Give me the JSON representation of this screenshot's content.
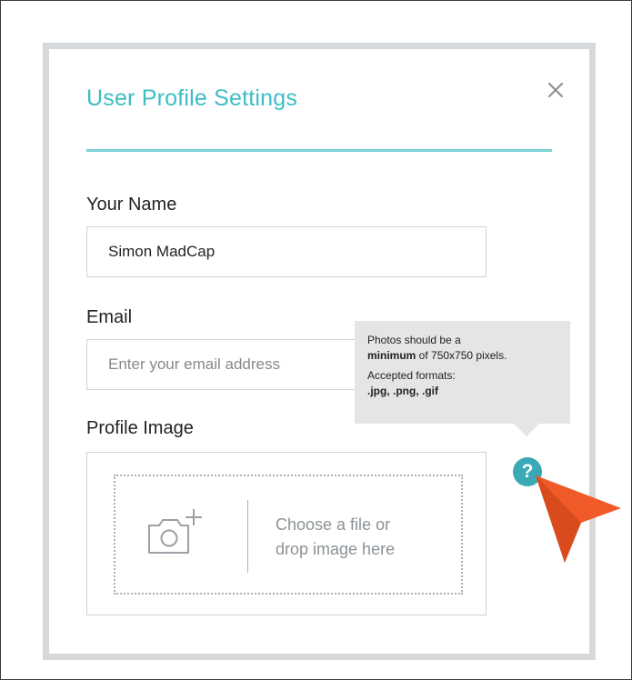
{
  "dialog": {
    "title": "User Profile Settings",
    "close_icon": "close-icon"
  },
  "fields": {
    "name_label": "Your Name",
    "name_value": "Simon MadCap",
    "email_label": "Email",
    "email_placeholder": "Enter your email address",
    "image_label": "Profile Image"
  },
  "upload": {
    "icon": "camera-add-icon",
    "line1": "Choose a file or",
    "line2": "drop image here"
  },
  "tooltip": {
    "line1": "Photos should be a",
    "line2_bold": "minimum",
    "line2_rest": " of 750x750 pixels.",
    "line3": "Accepted formats:",
    "line4": ".jpg, .png, .gif"
  },
  "help": {
    "symbol": "?",
    "icon": "help-icon"
  },
  "colors": {
    "accent": "#3dbdc3",
    "help": "#3aa9b6",
    "pointer": "#f05a28",
    "dialog_border": "#d6d9dc"
  }
}
